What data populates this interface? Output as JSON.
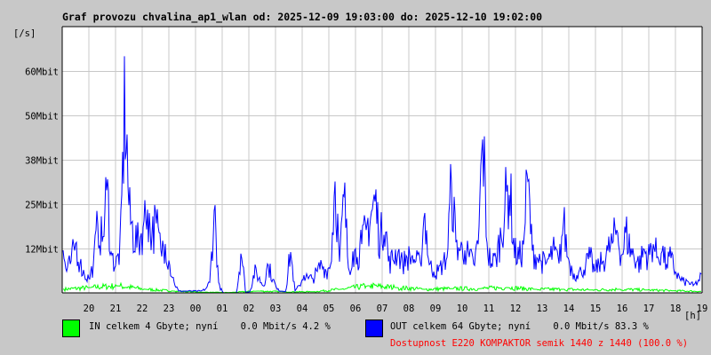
{
  "chart_data": {
    "type": "line",
    "title": "Graf provozu chvalina_ap1_wlan od: 2025-12-09 19:03:00 do: 2025-12-10 19:02:00",
    "ylabel": "[/s]",
    "xlabel": "[h]",
    "ylim": [
      0,
      75
    ],
    "y_unit": "Mbit",
    "y_ticks": [
      {
        "value": 12.5,
        "label": "12Mbit"
      },
      {
        "value": 25,
        "label": "25Mbit"
      },
      {
        "value": 37.5,
        "label": "38Mbit"
      },
      {
        "value": 50,
        "label": "50Mbit"
      },
      {
        "value": 62.5,
        "label": "60Mbit"
      }
    ],
    "x_range_hours": [
      19,
      43
    ],
    "x_ticks": [
      "20",
      "21",
      "22",
      "23",
      "00",
      "01",
      "02",
      "03",
      "04",
      "05",
      "06",
      "07",
      "08",
      "09",
      "10",
      "11",
      "12",
      "13",
      "14",
      "15",
      "16",
      "17",
      "18",
      "19"
    ],
    "grid": true,
    "sample_interval_minutes": 10,
    "series": [
      {
        "name": "OUT",
        "color": "#0000ff",
        "values": [
          12,
          6,
          9,
          14,
          8,
          5,
          4,
          8,
          20,
          14,
          30,
          10,
          8,
          12,
          55,
          22,
          16,
          14,
          18,
          24,
          16,
          20,
          12,
          14,
          8,
          3,
          0.5,
          0.5,
          0.5,
          0.5,
          0.5,
          0.5,
          1,
          3,
          24,
          2,
          0,
          0,
          0,
          0,
          12,
          0,
          0.5,
          6,
          4,
          2,
          8,
          4,
          1,
          0.5,
          0.5,
          12,
          0.5,
          2,
          5,
          4,
          4,
          6,
          8,
          6,
          8,
          32,
          8,
          28,
          6,
          12,
          10,
          14,
          18,
          22,
          26,
          14,
          22,
          8,
          10,
          12,
          8,
          10,
          10,
          9,
          8,
          23,
          8,
          6,
          6,
          8,
          10,
          31,
          14,
          12,
          12,
          10,
          8,
          14,
          45,
          12,
          8,
          10,
          16,
          25,
          30,
          12,
          10,
          12,
          33,
          12,
          10,
          9,
          8,
          10,
          12,
          8,
          20,
          10,
          6,
          5,
          6,
          8,
          10,
          6,
          8,
          9,
          12,
          14,
          18,
          10,
          17,
          12,
          10,
          8,
          12,
          10,
          14,
          10,
          12,
          8,
          10,
          6,
          4,
          3,
          3,
          2,
          3,
          5
        ]
      },
      {
        "name": "IN",
        "color": "#00ff00",
        "hourly_values": [
          1,
          1.5,
          2,
          1,
          0.5,
          0.2,
          0.1,
          0.5,
          0.3,
          0.3,
          1,
          2,
          1.5,
          1,
          1.2,
          1.2,
          1.5,
          1,
          1,
          0.8,
          1,
          0.8,
          0.6,
          0.4
        ]
      }
    ]
  },
  "legend": {
    "in_text": "IN celkem 4 Gbyte; nyní    0.0 Mbit/s 4.2 %",
    "out_text": "OUT celkem 64 Gbyte; nyní    0.0 Mbit/s 83.3 %",
    "availability_text": "Dostupnost E220 KOMPAKTOR semik 1440 z 1440 (100.0 %)",
    "in_color": "#00ff00",
    "out_color": "#0000ff"
  }
}
